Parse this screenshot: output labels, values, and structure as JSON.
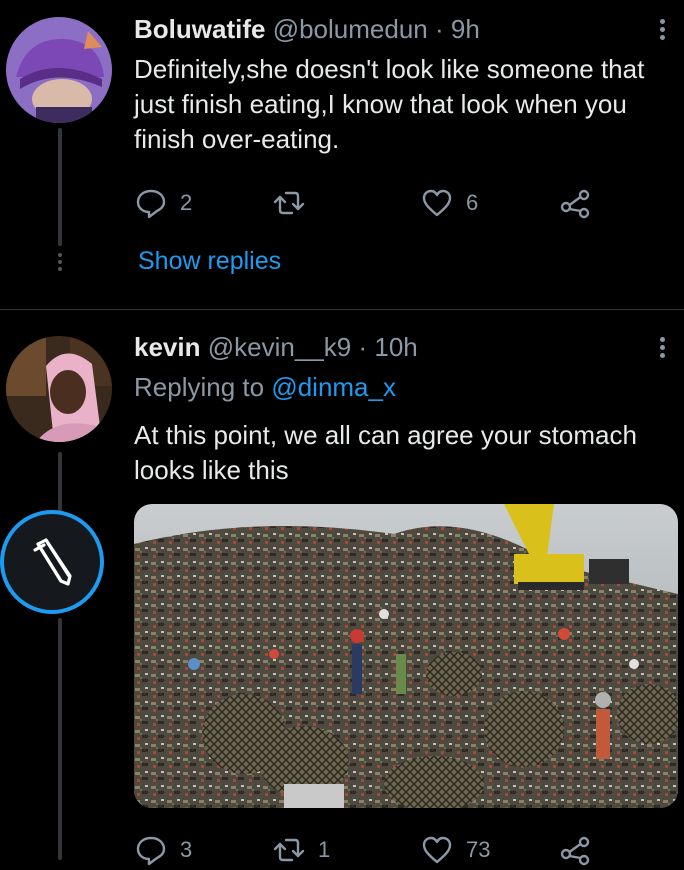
{
  "tweet1": {
    "name": "Boluwatife",
    "handle": "@bolumedun",
    "sep": "·",
    "time": "9h",
    "text": "Definitely,she doesn't look like someone that just finish eating,I know that look when you finish over-eating.",
    "reply_count": "2",
    "retweet_count": "",
    "like_count": "6",
    "show_replies": "Show replies"
  },
  "tweet2": {
    "name": "kevin",
    "handle": "@kevin__k9",
    "sep": "·",
    "time": "10h",
    "replying_prefix": "Replying to",
    "replying_to": "@dinma_x",
    "text": "At this point, we all can agree your stomach looks like this",
    "reply_count": "3",
    "retweet_count": "1",
    "like_count": "73"
  },
  "icons": [
    "reply-icon",
    "retweet-icon",
    "like-icon",
    "share-icon",
    "more-icon",
    "compose-icon"
  ],
  "colors": {
    "background": "#000000",
    "accent": "#1d9bf0",
    "muted": "#8b98a5"
  }
}
